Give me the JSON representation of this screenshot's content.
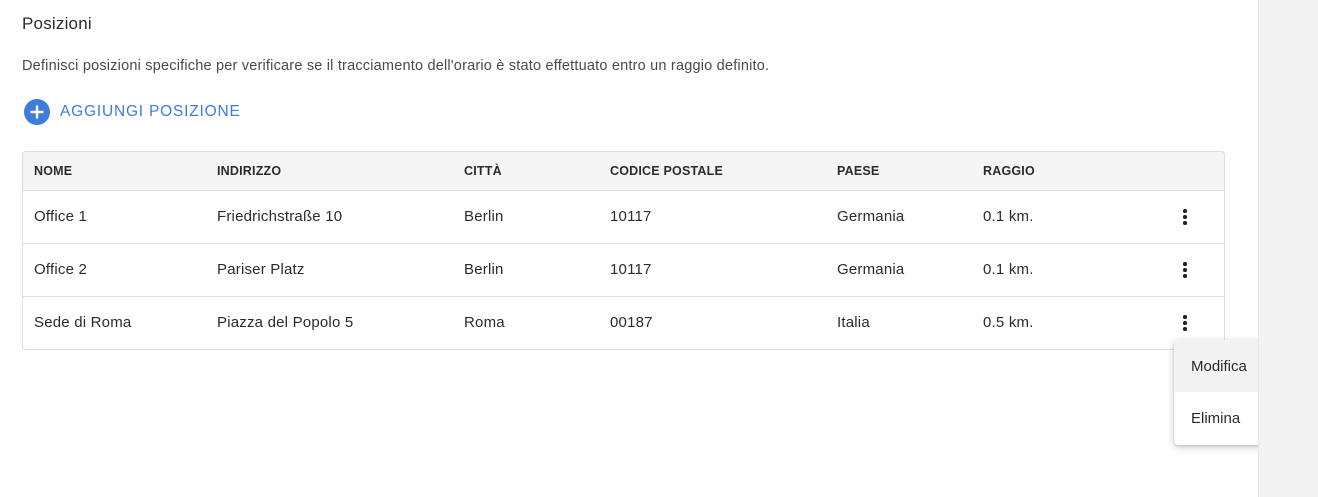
{
  "section": {
    "title": "Posizioni",
    "description": "Definisci posizioni specifiche per verificare se il tracciamento dell'orario è stato effettuato entro un raggio definito.",
    "add_label": "AGGIUNGI POSIZIONE",
    "add_icon": "plus-circle-icon"
  },
  "colors": {
    "accent": "#3d7ddb",
    "header_bg": "#f5f5f5",
    "right_panel_bg": "#f2f2f2"
  },
  "table": {
    "columns": [
      "NOME",
      "INDIRIZZO",
      "CITTÀ",
      "CODICE POSTALE",
      "PAESE",
      "RAGGIO"
    ],
    "rows": [
      {
        "nome": "Office 1",
        "indirizzo": "Friedrichstraße 10",
        "citta": "Berlin",
        "cap": "10117",
        "paese": "Germania",
        "raggio": "0.1 km."
      },
      {
        "nome": "Office 2",
        "indirizzo": "Pariser Platz",
        "citta": "Berlin",
        "cap": "10117",
        "paese": "Germania",
        "raggio": "0.1 km."
      },
      {
        "nome": "Sede di Roma",
        "indirizzo": "Piazza del Popolo 5",
        "citta": "Roma",
        "cap": "00187",
        "paese": "Italia",
        "raggio": "0.5 km."
      }
    ],
    "row_menu_icon": "more-vertical-icon"
  },
  "context_menu": {
    "items": [
      "Modifica",
      "Elimina"
    ]
  }
}
